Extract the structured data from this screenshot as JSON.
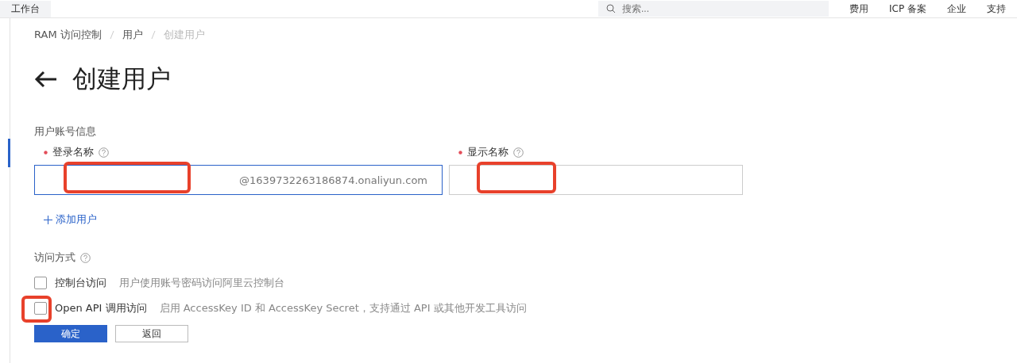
{
  "topbar": {
    "workspace": "工作台",
    "search": {
      "placeholder": "搜索..."
    },
    "links": [
      "费用",
      "ICP 备案",
      "企业",
      "支持"
    ]
  },
  "breadcrumb": [
    {
      "label": "RAM 访问控制",
      "current": false
    },
    {
      "label": "用户",
      "current": false
    },
    {
      "label": "创建用户",
      "current": true
    }
  ],
  "title": "创建用户",
  "section": "用户账号信息",
  "fields": [
    {
      "label": "登录名称",
      "required": true,
      "suffix": "@1639732263186874.onaliyun.com",
      "focused": true,
      "redacted": true
    },
    {
      "label": "显示名称",
      "required": true,
      "focused": false,
      "redacted": true
    }
  ],
  "add_user": "添加用户",
  "access": {
    "label": "访问方式",
    "options": [
      {
        "label": "控制台访问",
        "description": "用户使用账号密码访问阿里云控制台",
        "checked": false,
        "highlighted": false
      },
      {
        "label": "Open API 调用访问",
        "description": "启用 AccessKey ID 和 AccessKey Secret，支持通过 API 或其他开发工具访问",
        "checked": false,
        "highlighted": true
      }
    ]
  },
  "buttons": [
    {
      "label": "确定",
      "kind": "primary"
    },
    {
      "label": "返回",
      "kind": "secondary"
    }
  ]
}
